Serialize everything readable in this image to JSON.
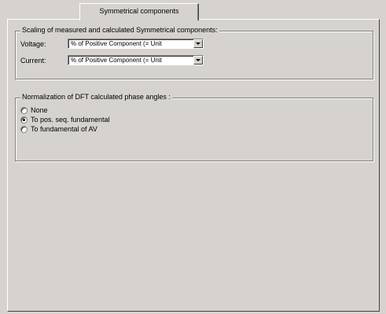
{
  "tabs": [
    {
      "label": "Symmetrical components",
      "active": true
    }
  ],
  "scaling_group": {
    "title": "Scaling of measured and calculated Symmetrical components:",
    "voltage": {
      "label": "Voltage:",
      "value": "% of Positive Component (= Unit"
    },
    "current": {
      "label": "Current:",
      "value": "% of Positive Component (= Unit"
    }
  },
  "normalization_group": {
    "title": "Normalization of DFT calculated phase angles :",
    "options": [
      {
        "label": "None",
        "checked": false
      },
      {
        "label": "To pos. seq. fundamental",
        "checked": true
      },
      {
        "label": "To fundamental of AV",
        "checked": false
      }
    ]
  }
}
